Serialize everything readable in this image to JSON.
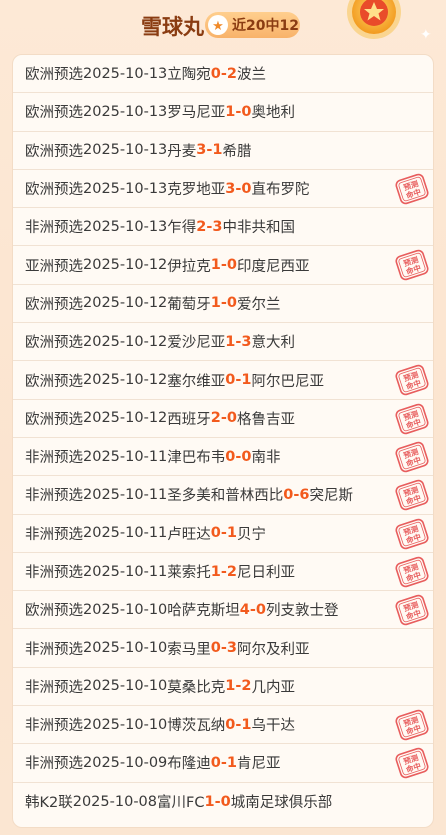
{
  "header": {
    "title": "雪球丸",
    "badge_text": "近20中12",
    "star_glyph": "★",
    "accent": "#f25a1d"
  },
  "stamp_text_line1": "预测",
  "stamp_text_line2": "命中",
  "matches": [
    {
      "league": "欧洲预选",
      "date": "2025-10-13",
      "home": "立陶宛",
      "hs": "0",
      "sep": " - ",
      "as": "2",
      "away": "波兰",
      "hit": false
    },
    {
      "league": "欧洲预选",
      "date": "2025-10-13",
      "home": "罗马尼亚",
      "hs": "1",
      "sep": " - ",
      "as": "0",
      "away": "奥地利",
      "hit": false
    },
    {
      "league": "欧洲预选",
      "date": "2025-10-13",
      "home": "丹麦",
      "hs": "3",
      "sep": " - ",
      "as": "1",
      "away": "希腊",
      "hit": false
    },
    {
      "league": "欧洲预选",
      "date": "2025-10-13",
      "home": "克罗地亚",
      "hs": "3",
      "sep": " - ",
      "as": "0",
      "away": "直布罗陀",
      "hit": true
    },
    {
      "league": "非洲预选",
      "date": "2025-10-13",
      "home": "乍得",
      "hs": "2",
      "sep": " - ",
      "as": "3",
      "away": "中非共和国",
      "hit": false
    },
    {
      "league": "亚洲预选",
      "date": "2025-10-12",
      "home": "伊拉克",
      "hs": "1",
      "sep": " - ",
      "as": "0",
      "away": "印度尼西亚",
      "hit": true
    },
    {
      "league": "欧洲预选",
      "date": "2025-10-12",
      "home": "葡萄牙",
      "hs": "1",
      "sep": " - ",
      "as": "0",
      "away": "爱尔兰",
      "hit": false
    },
    {
      "league": "欧洲预选",
      "date": "2025-10-12",
      "home": "爱沙尼亚",
      "hs": "1",
      "sep": " - ",
      "as": "3",
      "away": "意大利",
      "hit": false
    },
    {
      "league": "欧洲预选",
      "date": "2025-10-12",
      "home": "塞尔维亚",
      "hs": "0",
      "sep": " - ",
      "as": "1",
      "away": "阿尔巴尼亚",
      "hit": true
    },
    {
      "league": "欧洲预选",
      "date": "2025-10-12",
      "home": "西班牙",
      "hs": "2",
      "sep": " - ",
      "as": "0",
      "away": "格鲁吉亚",
      "hit": true
    },
    {
      "league": "非洲预选",
      "date": "2025-10-11",
      "home": "津巴布韦",
      "hs": "0",
      "sep": " - ",
      "as": "0",
      "away": "南非",
      "hit": true
    },
    {
      "league": "非洲预选",
      "date": "2025-10-11",
      "home": "圣多美和普林西比",
      "hs": "0",
      "sep": " - ",
      "as": "6",
      "away": "突尼斯",
      "hit": true
    },
    {
      "league": "非洲预选",
      "date": "2025-10-11",
      "home": "卢旺达",
      "hs": "0",
      "sep": " - ",
      "as": "1",
      "away": "贝宁",
      "hit": true
    },
    {
      "league": "非洲预选",
      "date": "2025-10-11",
      "home": "莱索托",
      "hs": "1",
      "sep": " - ",
      "as": "2",
      "away": "尼日利亚",
      "hit": true
    },
    {
      "league": "欧洲预选",
      "date": "2025-10-10",
      "home": "哈萨克斯坦",
      "hs": "4",
      "sep": " - ",
      "as": "0",
      "away": "列支敦士登",
      "hit": true
    },
    {
      "league": "非洲预选",
      "date": "2025-10-10",
      "home": "索马里",
      "hs": "0",
      "sep": " - ",
      "as": "3",
      "away": "阿尔及利亚",
      "hit": false
    },
    {
      "league": "非洲预选",
      "date": "2025-10-10",
      "home": "莫桑比克",
      "hs": "1",
      "sep": " - ",
      "as": "2",
      "away": "几内亚",
      "hit": false
    },
    {
      "league": "非洲预选",
      "date": "2025-10-10",
      "home": "博茨瓦纳",
      "hs": "0",
      "sep": " - ",
      "as": "1",
      "away": "乌干达",
      "hit": true
    },
    {
      "league": "非洲预选",
      "date": "2025-10-09",
      "home": "布隆迪",
      "hs": "0",
      "sep": " - ",
      "as": "1",
      "away": "肯尼亚",
      "hit": true
    },
    {
      "league": "韩K2联",
      "date": "2025-10-08",
      "home": "富川FC",
      "hs": "1",
      "sep": " - ",
      "as": "0",
      "away": "城南足球俱乐部",
      "hit": false
    }
  ]
}
